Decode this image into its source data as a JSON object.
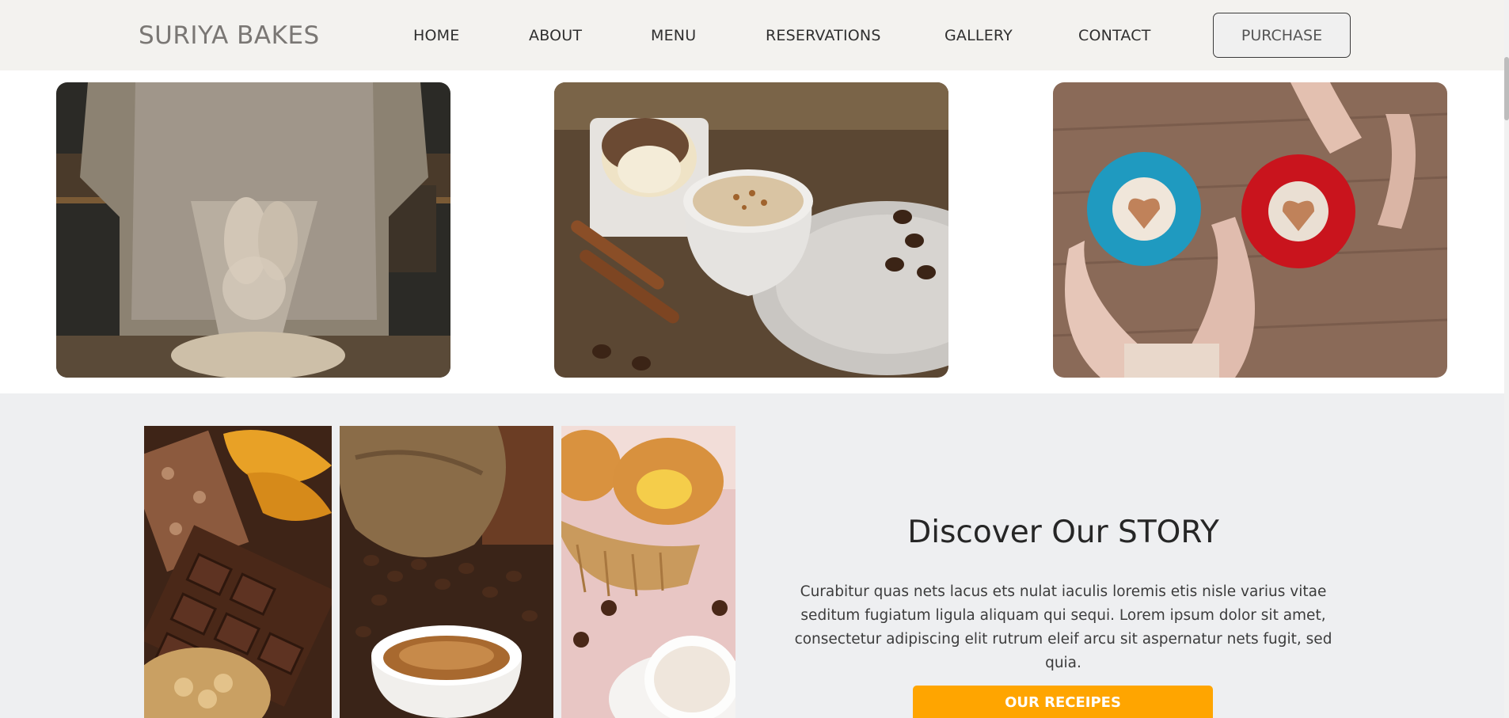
{
  "nav": {
    "brand": "SURIYA BAKES",
    "links": [
      "HOME",
      "ABOUT",
      "MENU",
      "RESERVATIONS",
      "GALLERY",
      "CONTACT"
    ],
    "purchase": "PURCHASE"
  },
  "story": {
    "title": "Discover Our STORY",
    "text": "Curabitur quas nets lacus ets nulat iaculis loremis etis nisle varius vitae seditum fugiatum ligula aliquam qui sequi. Lorem ipsum dolor sit amet, consectetur adipiscing elit rutrum eleif arcu sit aspernatur nets fugit, sed quia.",
    "button": "OUR RECEIPES"
  },
  "colors": {
    "nav_bg": "#f3f2ef",
    "section_bg": "#eeeff1",
    "accent": "#ffa500"
  }
}
